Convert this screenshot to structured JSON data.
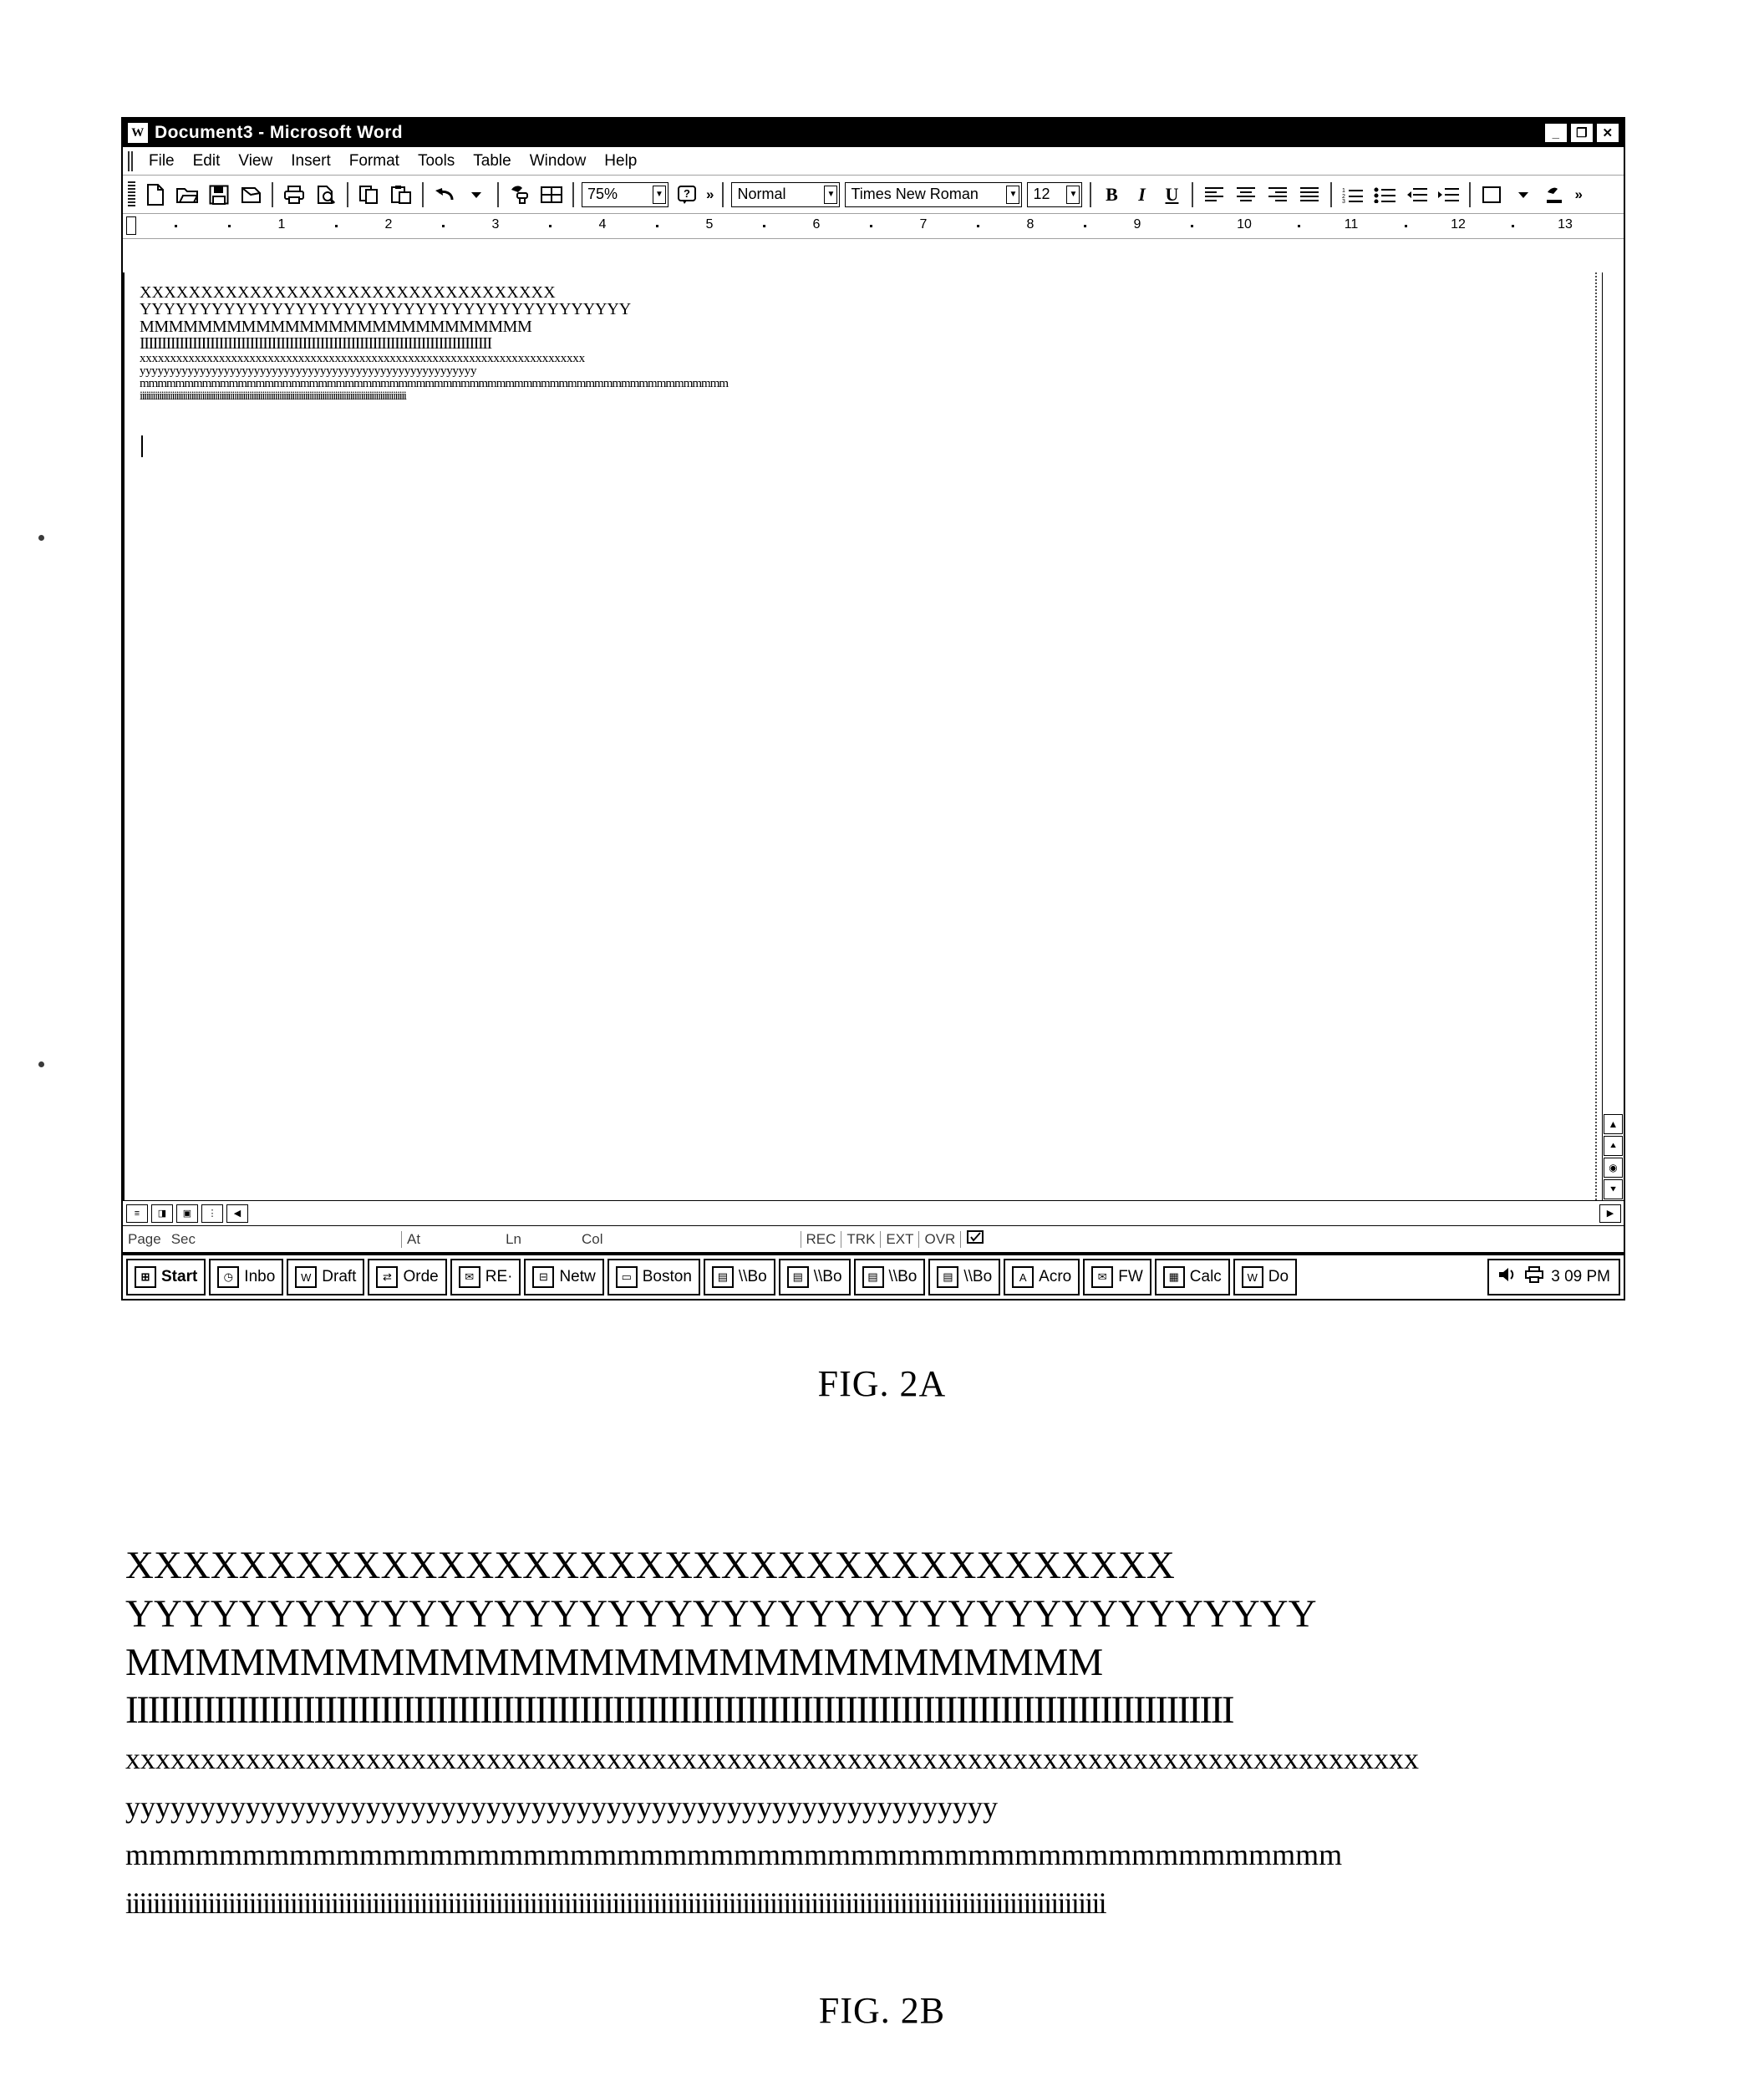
{
  "figures": {
    "fig_2a_caption": "FIG. 2A",
    "fig_2b_caption": "FIG. 2B"
  },
  "word_window": {
    "title": "Document3 - Microsoft Word",
    "app_icon": "word-document-icon",
    "window_controls": {
      "minimize": "_",
      "restore": "❐",
      "close": "✕"
    },
    "menu": [
      {
        "label": "File"
      },
      {
        "label": "Edit"
      },
      {
        "label": "View"
      },
      {
        "label": "Insert"
      },
      {
        "label": "Format"
      },
      {
        "label": "Tools"
      },
      {
        "label": "Table"
      },
      {
        "label": "Window"
      },
      {
        "label": "Help"
      }
    ],
    "standard_toolbar": {
      "buttons": [
        "new-document-icon",
        "open-folder-icon",
        "save-disk-icon",
        "email-icon",
        "print-icon",
        "print-preview-icon",
        "copy-icon",
        "paste-icon",
        "undo-icon",
        "undo-dropdown-icon",
        "format-painter-icon",
        "insert-table-icon"
      ],
      "zoom_value": "75%",
      "help_icon": "help-question-icon",
      "overflow_label": "»"
    },
    "formatting_toolbar": {
      "style_value": "Normal",
      "font_value": "Times New Roman",
      "size_value": "12",
      "bold_label": "B",
      "italic_label": "I",
      "underline_label": "U",
      "buttons": [
        "align-left-icon",
        "align-center-icon",
        "align-right-icon",
        "align-justify-icon",
        "numbered-list-icon",
        "bulleted-list-icon",
        "decrease-indent-icon",
        "increase-indent-icon",
        "borders-icon",
        "highlight-icon",
        "font-color-icon",
        "overflow-icon"
      ]
    },
    "ruler": {
      "numbers": [
        "1",
        "2",
        "3",
        "4",
        "5",
        "6",
        "7",
        "8",
        "9",
        "10",
        "11",
        "12",
        "13"
      ]
    },
    "document_lines": [
      "XXXXXXXXXXXXXXXXXXXXXXXXXXXXXXXXXX",
      "YYYYYYYYYYYYYYYYYYYYYYYYYYYYYYYYYYYYYYYYY",
      "MMMMMMMMMMMMMMMMMMMMMMMMMMM",
      "IIIIIIIIIIIIIIIIIIIIIIIIIIIIIIIIIIIIIIIIIIIIIIIIIIIIIIIIIIIIIIIIIIIIIIIIIIIIIIII",
      "xxxxxxxxxxxxxxxxxxxxxxxxxxxxxxxxxxxxxxxxxxxxxxxxxxxxxxxxxxxxxxxxxxxxxxxxx",
      "yyyyyyyyyyyyyyyyyyyyyyyyyyyyyyyyyyyyyyyyyyyyyyyyyyyyyyyy",
      "mmmmmmmmmmmmmmmmmmmmmmmmmmmmmmmmmmmmmmmmmmmmmmmmmmmmmmmmmmmmmmmmmm",
      "iiiiiiiiiiiiiiiiiiiiiiiiiiiiiiiiiiiiiiiiiiiiiiiiiiiiiiiiiiiiiiiiiiiiiiiiiiiiiiiiiiiiiiiiiiiiiiiiiiiiiiiiiiiiiiiiiiiiiiiiiiii"
    ],
    "status_bar": {
      "page_label": "Page",
      "sec_label": "Sec",
      "at_label": "At",
      "ln_label": "Ln",
      "col_label": "Col",
      "rec_label": "REC",
      "trk_label": "TRK",
      "ext_label": "EXT",
      "ovr_label": "OVR",
      "spell_icon": "spell-check-icon"
    },
    "view_buttons": [
      "normal-view-icon",
      "web-layout-view-icon",
      "print-layout-view-icon",
      "outline-view-icon"
    ]
  },
  "taskbar": {
    "start_label": "Start",
    "start_icon": "windows-flag-icon",
    "items": [
      {
        "label": "Inbo",
        "icon": "outlook-clock-icon"
      },
      {
        "label": "Draft",
        "icon": "word-document-icon"
      },
      {
        "label": "Orde",
        "icon": "refresh-arrows-icon"
      },
      {
        "label": "RE·",
        "icon": "envelope-icon"
      },
      {
        "label": "Netw",
        "icon": "network-neighborhood-icon"
      },
      {
        "label": "Boston",
        "icon": "monitor-icon"
      },
      {
        "label": "\\\\Bo",
        "icon": "folder-icon"
      },
      {
        "label": "\\\\Bo",
        "icon": "folder-window-icon"
      },
      {
        "label": "\\\\Bo",
        "icon": "folder-window-icon"
      },
      {
        "label": "\\\\Bo",
        "icon": "folder-window-icon"
      },
      {
        "label": "Acro",
        "icon": "acrobat-icon"
      },
      {
        "label": "FW",
        "icon": "envelope-icon"
      },
      {
        "label": "Calc",
        "icon": "calculator-icon"
      },
      {
        "label": "Do",
        "icon": "word-document-icon"
      }
    ],
    "tray": {
      "icons": [
        "speaker-icon",
        "printer-icon"
      ],
      "clock": "3 09 PM"
    }
  },
  "fig_2b": {
    "lines": [
      {
        "text": "XXXXXXXXXXXXXXXXXXXXXXXXXXXXXXXXXXXXX",
        "case": "upper"
      },
      {
        "text": "YYYYYYYYYYYYYYYYYYYYYYYYYYYYYYYYYYYYYYYYYY",
        "case": "upper"
      },
      {
        "text": "MMMMMMMMMMMMMMMMMMMMMMMMMMMM",
        "case": "upper"
      },
      {
        "text": "IIIIIIIIIIIIIIIIIIIIIIIIIIIIIIIIIIIIIIIIIIIIIIIIIIIIIIIIIIIIIIIIIIIIIIIIIIIIIIIIIIIIIIIIIIIIIIIIIIII",
        "case": "upper-tight"
      },
      {
        "text": "xxxxxxxxxxxxxxxxxxxxxxxxxxxxxxxxxxxxxxxxxxxxxxxxxxxxxxxxxxxxxxxxxxxxxxxxxxxxxxxxxxxxxx",
        "case": "lower"
      },
      {
        "text": "yyyyyyyyyyyyyyyyyyyyyyyyyyyyyyyyyyyyyyyyyyyyyyyyyyyyyyyyyy",
        "case": "lower"
      },
      {
        "text": "mmmmmmmmmmmmmmmmmmmmmmmmmmmmmmmmmmmmmmmmmmmmmmmmmmmm",
        "case": "lower"
      },
      {
        "text": "iiiiiiiiiiiiiiiiiiiiiiiiiiiiiiiiiiiiiiiiiiiiiiiiiiiiiiiiiiiiiiiiiiiiiiiiiiiiiiiiiiiiiiiiiiiiiiiiiiiiiiiiiiiiiiiiiiiiiiiiiiiiiiiiiiiiiiiiiiiiiii",
        "case": "lower-tighter"
      }
    ]
  },
  "colors": {
    "ink": "#000000",
    "paper": "#ffffff",
    "chrome_gray": "#bdbdbd"
  }
}
